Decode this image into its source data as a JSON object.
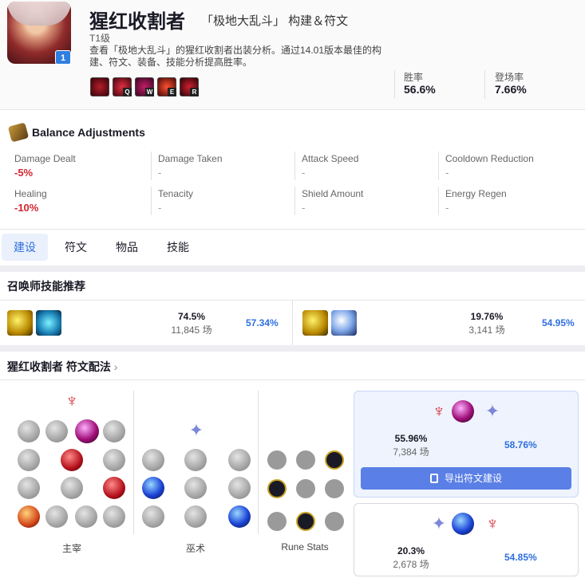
{
  "header": {
    "champion_name": "猩红收割者",
    "mode_title": "「极地大乱斗」 构建＆符文",
    "tier_badge": "1",
    "tier_text": "T1级",
    "description": "查看「极地大乱斗」的猩红收割者出装分析。通过14.01版本最佳的构建、符文、装备、技能分析提高胜率。",
    "skills": [
      {
        "key": "",
        "icon": "passive-icon"
      },
      {
        "key": "Q",
        "icon": "q-skill-icon"
      },
      {
        "key": "W",
        "icon": "w-skill-icon"
      },
      {
        "key": "E",
        "icon": "e-skill-icon"
      },
      {
        "key": "R",
        "icon": "r-skill-icon"
      }
    ],
    "stats": [
      {
        "label": "胜率",
        "value": "56.6%"
      },
      {
        "label": "登场率",
        "value": "7.66%"
      }
    ]
  },
  "balance": {
    "title": "Balance Adjustments",
    "items": [
      {
        "label": "Damage Dealt",
        "value": "-5%",
        "kind": "neg"
      },
      {
        "label": "Damage Taken",
        "value": "-",
        "kind": "neutral"
      },
      {
        "label": "Attack Speed",
        "value": "-",
        "kind": "neutral"
      },
      {
        "label": "Cooldown Reduction",
        "value": "-",
        "kind": "neutral"
      },
      {
        "label": "Healing",
        "value": "-10%",
        "kind": "neg"
      },
      {
        "label": "Tenacity",
        "value": "-",
        "kind": "neutral"
      },
      {
        "label": "Shield Amount",
        "value": "-",
        "kind": "neutral"
      },
      {
        "label": "Energy Regen",
        "value": "-",
        "kind": "neutral"
      }
    ]
  },
  "tabs": [
    {
      "label": "建设",
      "active": true
    },
    {
      "label": "符文",
      "active": false
    },
    {
      "label": "物品",
      "active": false
    },
    {
      "label": "技能",
      "active": false
    }
  ],
  "summoners": {
    "title": "召唤师技能推荐",
    "options": [
      {
        "spells": [
          "ghost-icon",
          "cleanse-icon"
        ],
        "pick_rate": "74.5%",
        "games": "11,845 场",
        "win_rate": "57.34%"
      },
      {
        "spells": [
          "ghost-icon",
          "snowball-icon"
        ],
        "pick_rate": "19.76%",
        "games": "3,141 场",
        "win_rate": "54.95%"
      }
    ]
  },
  "runes": {
    "title": "猩红收割者 符文配法",
    "chevron": "›",
    "columns": [
      "主宰",
      "巫术",
      "Rune Stats"
    ],
    "recommend": [
      {
        "pick_rate": "55.96%",
        "games": "7,384 场",
        "win_rate": "58.76%"
      },
      {
        "pick_rate": "20.3%",
        "games": "2,678 场",
        "win_rate": "54.85%"
      }
    ],
    "export_label": "导出符文建设"
  },
  "colors": {
    "accent": "#2f6fe0",
    "negative": "#d4242e",
    "domination": "#d4242e",
    "sorcery": "#7c87d8"
  }
}
